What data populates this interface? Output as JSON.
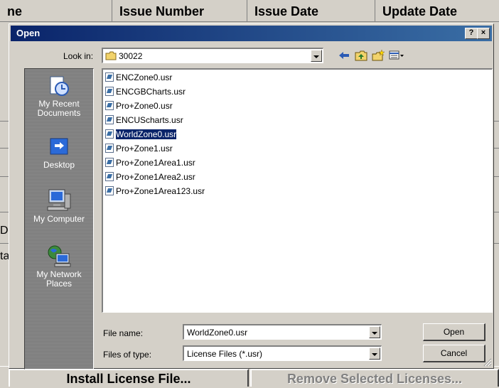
{
  "background_app": {
    "columns": [
      "ne",
      "Issue Number",
      "Issue Date",
      "Update Date"
    ],
    "left_fragments": [
      "D",
      "ta"
    ],
    "install_button": "Install License File...",
    "remove_button": "Remove Selected Licenses..."
  },
  "dialog": {
    "title": "Open",
    "help_button": "?",
    "close_button": "×",
    "look_in_label": "Look in:",
    "look_in_value": "30022",
    "places": [
      {
        "label": "My Recent Documents"
      },
      {
        "label": "Desktop"
      },
      {
        "label": "My Computer"
      },
      {
        "label": "My Network Places"
      }
    ],
    "files": [
      {
        "name": "ENCZone0.usr",
        "selected": false
      },
      {
        "name": "ENCGBCharts.usr",
        "selected": false
      },
      {
        "name": "Pro+Zone0.usr",
        "selected": false
      },
      {
        "name": "ENCUScharts.usr",
        "selected": false
      },
      {
        "name": "WorldZone0.usr",
        "selected": true
      },
      {
        "name": "Pro+Zone1.usr",
        "selected": false
      },
      {
        "name": "Pro+Zone1Area1.usr",
        "selected": false
      },
      {
        "name": "Pro+Zone1Area2.usr",
        "selected": false
      },
      {
        "name": "Pro+Zone1Area123.usr",
        "selected": false
      }
    ],
    "file_name_label": "File name:",
    "file_name_value": "WorldZone0.usr",
    "file_type_label": "Files of type:",
    "file_type_value": "License Files (*.usr)",
    "open_button": "Open",
    "cancel_button": "Cancel"
  },
  "colors": {
    "titlebar": "#0a246a",
    "selection": "#0a246a",
    "face": "#d4d0c8"
  }
}
